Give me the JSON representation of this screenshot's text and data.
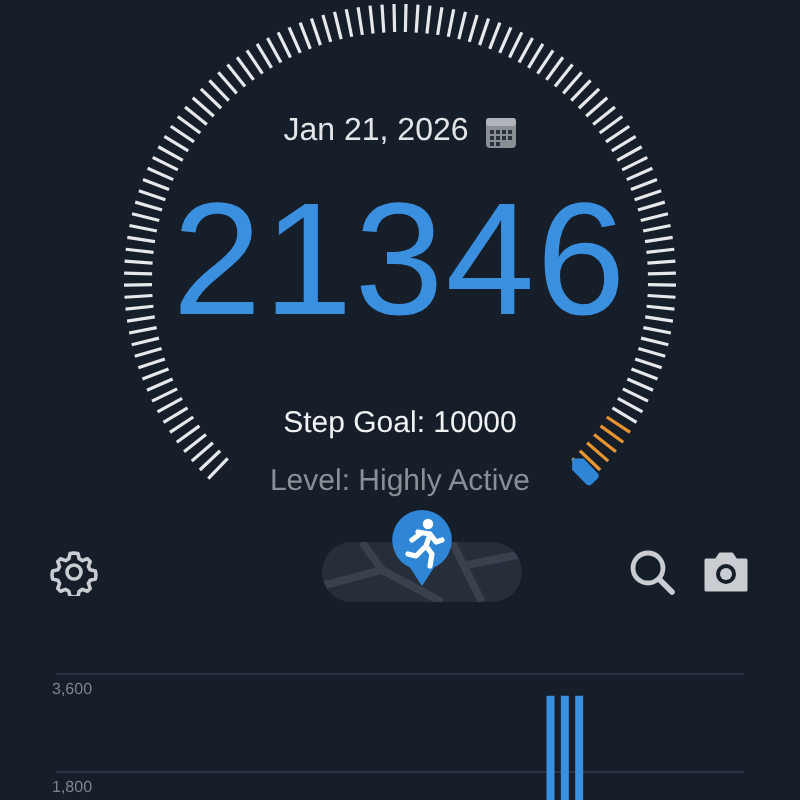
{
  "gauge": {
    "date": "Jan 21, 2026",
    "steps": "21346",
    "goal": "Step Goal: 10000",
    "activity": "Level: Highly Active"
  },
  "toolbar": {
    "map_toggle": {
      "on": true
    }
  },
  "chart": {
    "chart_data": {
      "type": "bar",
      "ylim": [
        0,
        3600
      ],
      "yticks": [
        {
          "value": 1800,
          "label": "1,800"
        },
        {
          "value": 3600,
          "label": "3,600"
        }
      ],
      "series": [
        {
          "color": "#3a8fdf",
          "values": [
            null,
            null,
            null,
            null,
            null,
            null,
            null,
            null,
            null,
            null,
            null,
            null,
            null,
            null,
            null,
            null,
            null,
            null,
            null,
            null,
            null,
            null,
            null,
            null,
            null,
            null,
            null,
            null,
            null,
            null,
            null,
            null,
            null,
            null,
            3200,
            3200,
            3200,
            null,
            null,
            null,
            null,
            null,
            null,
            null,
            null,
            null,
            null,
            null
          ]
        }
      ]
    }
  }
}
